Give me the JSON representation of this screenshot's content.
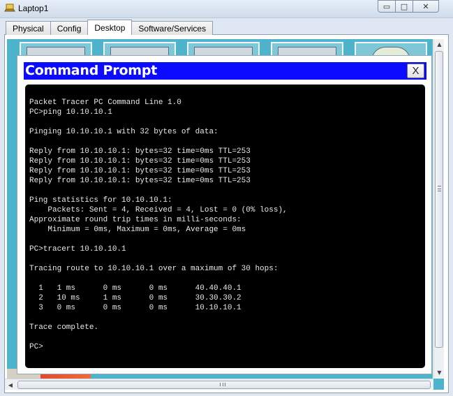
{
  "window": {
    "title": "Laptop1",
    "buttons": {
      "minimize": "▭",
      "maximize": "□",
      "close": "✕"
    }
  },
  "tabs": [
    {
      "label": "Physical",
      "active": false
    },
    {
      "label": "Config",
      "active": false
    },
    {
      "label": "Desktop",
      "active": true
    },
    {
      "label": "Software/Services",
      "active": false
    }
  ],
  "command_prompt": {
    "title": "Command Prompt",
    "close_label": "X",
    "lines": [
      "Packet Tracer PC Command Line 1.0",
      "PC>ping 10.10.10.1",
      "",
      "Pinging 10.10.10.1 with 32 bytes of data:",
      "",
      "Reply from 10.10.10.1: bytes=32 time=0ms TTL=253",
      "Reply from 10.10.10.1: bytes=32 time=0ms TTL=253",
      "Reply from 10.10.10.1: bytes=32 time=0ms TTL=253",
      "Reply from 10.10.10.1: bytes=32 time=0ms TTL=253",
      "",
      "Ping statistics for 10.10.10.1:",
      "    Packets: Sent = 4, Received = 4, Lost = 0 (0% loss),",
      "Approximate round trip times in milli-seconds:",
      "    Minimum = 0ms, Maximum = 0ms, Average = 0ms",
      "",
      "PC>tracert 10.10.10.1",
      "",
      "Tracing route to 10.10.10.1 over a maximum of 30 hops:",
      "",
      "  1   1 ms      0 ms      0 ms      40.40.40.1",
      "  2   10 ms     1 ms      0 ms      30.30.30.2",
      "  3   0 ms      0 ms      0 ms      10.10.10.1",
      "",
      "Trace complete.",
      "",
      "PC>"
    ]
  },
  "colors": {
    "header_blue": "#0b0bff",
    "desktop_bg": "#4db4cc",
    "terminal_bg": "#000000",
    "terminal_text": "#e8e8e8"
  }
}
